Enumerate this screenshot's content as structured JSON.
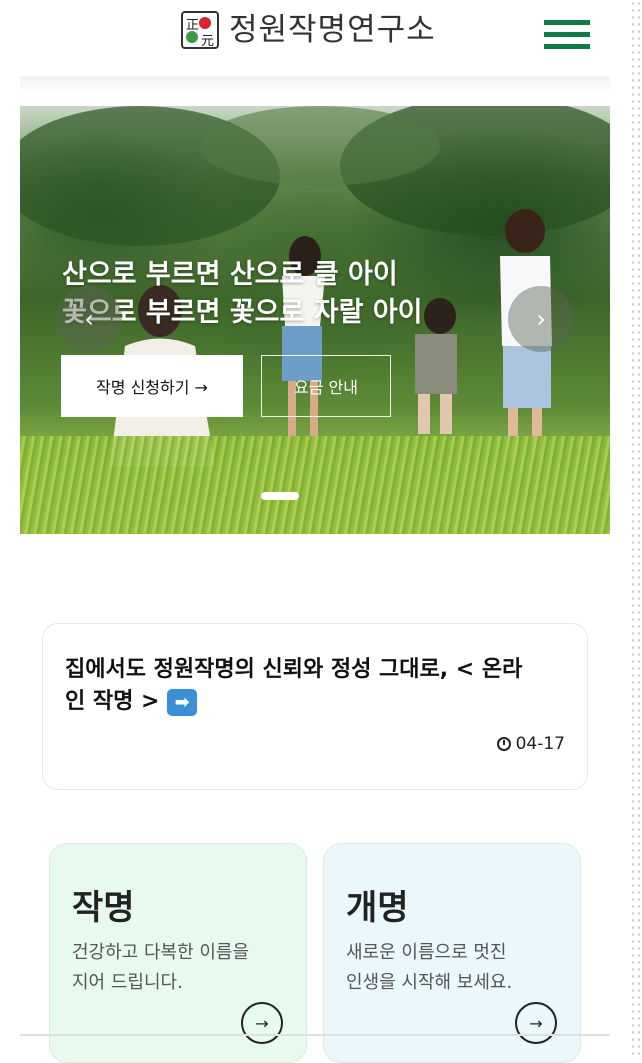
{
  "header": {
    "logo_seal_text": "正元",
    "logo_text": "정원작명연구소",
    "menu_icon": "hamburger-icon",
    "accent_color": "#0f7a48"
  },
  "hero": {
    "title_line1": "산으로 부르면 산으로 클 아이",
    "title_line2": "꽃으로 부르면 꽃으로 자랄 아이",
    "apply_button": "작명 신청하기 →",
    "price_button": "요금 안내",
    "prev_icon": "chevron-left-icon",
    "next_icon": "chevron-right-icon",
    "prev_glyph": "‹",
    "next_glyph": "›"
  },
  "notice": {
    "title": "집에서도 정원작명의 신뢰와 정성 그대로, < 온라인 작명 >",
    "arrow_glyph": "➡",
    "date": "04-17"
  },
  "services": [
    {
      "title": "작명",
      "desc_line1": "건강하고 다복한 이름을",
      "desc_line2": "지어 드립니다.",
      "go_glyph": "→",
      "bg_color": "#e7faf0"
    },
    {
      "title": "개명",
      "desc_line1": "새로운 이름으로 멋진",
      "desc_line2": "인생을 시작해 보세요.",
      "go_glyph": "→",
      "bg_color": "#eaf7fb"
    }
  ]
}
